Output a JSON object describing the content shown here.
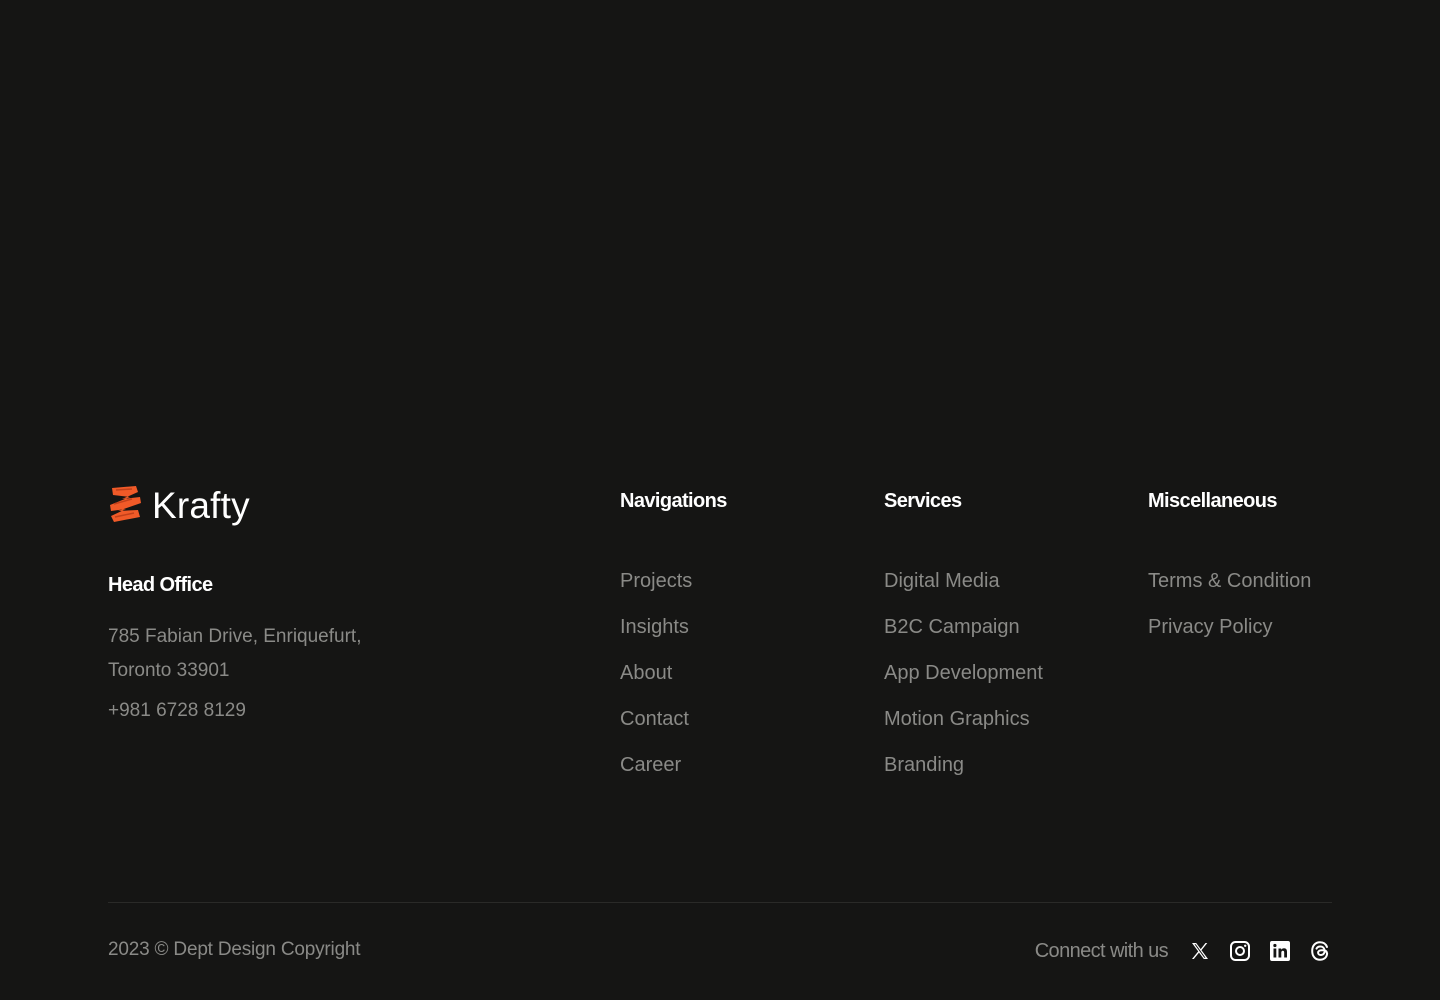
{
  "brand": {
    "name": "Krafty",
    "accent_color": "#F05A28",
    "logo_icon": "krafty-z-logo-icon"
  },
  "office": {
    "title": "Head Office",
    "address": "785 Fabian Drive, Enriquefurt, Toronto 33901",
    "phone": "+981 6728 8129"
  },
  "navigations": {
    "title": "Navigations",
    "items": [
      "Projects",
      "Insights",
      "About",
      "Contact",
      "Career"
    ]
  },
  "services": {
    "title": "Services",
    "items": [
      "Digital Media",
      "B2C Campaign",
      "App Development",
      "Motion Graphics",
      "Branding"
    ]
  },
  "miscellaneous": {
    "title": "Miscellaneous",
    "items": [
      "Terms & Condition",
      "Privacy Policy"
    ]
  },
  "footer": {
    "copyright": "2023 © Dept Design Copyright",
    "connect_label": "Connect with us",
    "socials": [
      "x-twitter-icon",
      "instagram-icon",
      "linkedin-icon",
      "threads-icon"
    ]
  },
  "colors": {
    "background": "#151514",
    "heading": "#FFFFFF",
    "muted_text": "#8A8A87"
  }
}
